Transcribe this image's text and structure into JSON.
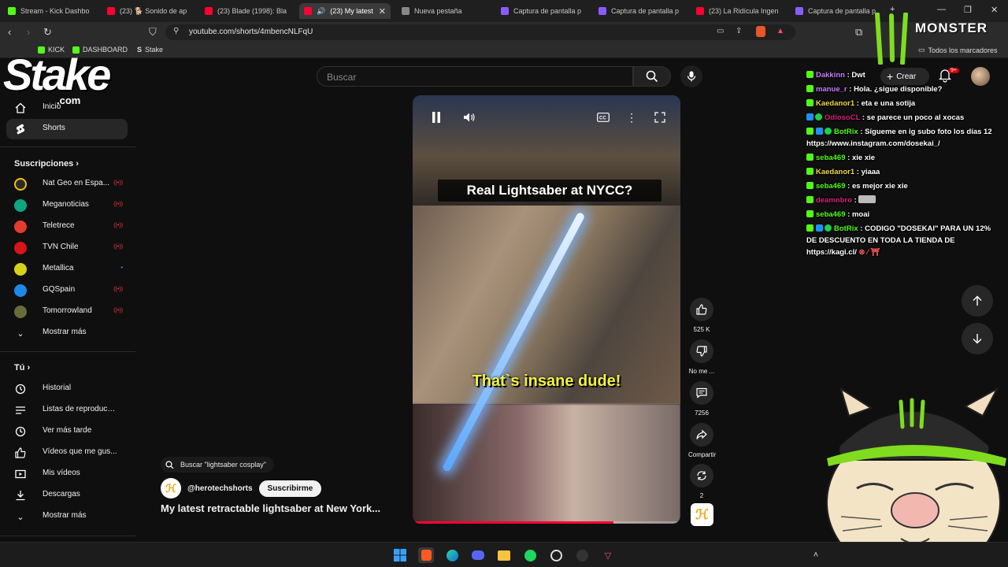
{
  "browser": {
    "tabs": [
      {
        "label": "Stream - Kick Dashbo",
        "color": "#53fc18"
      },
      {
        "label": "(23) 🐕 Sonido de ap",
        "color": "#ff0033"
      },
      {
        "label": "(23) Blade (1998): Bla",
        "color": "#ff0033"
      },
      {
        "label": "(23) My latest",
        "color": "#ff0033",
        "active": true
      },
      {
        "label": "Nueva pestaña",
        "color": "#888888"
      },
      {
        "label": "Captura de pantalla p",
        "color": "#8a5cff"
      },
      {
        "label": "Captura de pantalla p",
        "color": "#8a5cff"
      },
      {
        "label": "(23) La Ridícula Ingen",
        "color": "#ff0033"
      },
      {
        "label": "Captura de pantalla p",
        "color": "#8a5cff"
      }
    ],
    "url": "youtube.com/shorts/4mbencNLFqU",
    "bookmarks": [
      "KICK",
      "DASHBOARD",
      "Stake"
    ],
    "bookmarks_all": "Todos los marcadores"
  },
  "search": {
    "placeholder": "Buscar"
  },
  "sidebar": {
    "main": [
      {
        "label": "Inicio",
        "icon": "home-icon"
      },
      {
        "label": "Shorts",
        "icon": "shorts-icon"
      }
    ],
    "subs_title": "Suscripciones",
    "subs": [
      {
        "label": "Nat Geo en Espa...",
        "color": "#2b2b2b"
      },
      {
        "label": "Meganoticias",
        "color": "#0ea683"
      },
      {
        "label": "Teletrece",
        "color": "#e33b2e"
      },
      {
        "label": "TVN Chile",
        "color": "#d7141a"
      },
      {
        "label": "Metallica",
        "color": "#d6d21a"
      },
      {
        "label": "GQSpain",
        "color": "#1e88e5"
      },
      {
        "label": "Tomorrowland",
        "color": "#6b6b3a"
      }
    ],
    "show_more": "Mostrar más",
    "you_title": "Tú",
    "you": [
      {
        "label": "Historial",
        "icon": "history-icon"
      },
      {
        "label": "Listas de reproducc...",
        "icon": "playlist-icon"
      },
      {
        "label": "Ver más tarde",
        "icon": "clock-icon"
      },
      {
        "label": "Vídeos que me gus...",
        "icon": "thumb-up-icon"
      },
      {
        "label": "Mis vídeos",
        "icon": "video-icon"
      },
      {
        "label": "Descargas",
        "icon": "download-icon"
      }
    ],
    "show_more_2": "Mostrar más"
  },
  "short": {
    "caption_top": "Real Lightsaber at NYCC?",
    "caption_bottom": "That`s insane dude!",
    "progress": 0.75,
    "actions": {
      "likes": "525 K",
      "dislike": "No me ...",
      "comments": "7256",
      "share": "Compartir",
      "remix": "2"
    },
    "search_chip": "Buscar \"lightsaber cosplay\"",
    "channel": "@herotechshorts",
    "subscribe": "Suscribirme",
    "title": "My latest retractable lightsaber at New York..."
  },
  "topright": {
    "create": "Crear",
    "notif_badge": "9+"
  },
  "chat": [
    {
      "user": "Dakkinn",
      "msg": "Dwt",
      "color": "#c77dff"
    },
    {
      "user": "manue_r",
      "msg": "Hola. ¿sigue disponible?",
      "color": "#c77dff"
    },
    {
      "user": "Kaedanor1",
      "msg": "eta e una sotija",
      "color": "#f5d742"
    },
    {
      "user": "OdiosoCL",
      "msg": "se parece un poco al xocas",
      "color": "#d9207a"
    },
    {
      "user": "BotRix",
      "msg": "Sígueme en ig subo foto los días 12 https://www.instagram.com/dosekai_/",
      "color": "#53fc18"
    },
    {
      "user": "seba469",
      "msg": "xie xie",
      "color": "#53fc18"
    },
    {
      "user": "Kaedanor1",
      "msg": "yiaaa",
      "color": "#f5d742"
    },
    {
      "user": "seba469",
      "msg": "es mejor xie xie",
      "color": "#53fc18"
    },
    {
      "user": "deamnbro",
      "msg": "",
      "color": "#d9207a"
    },
    {
      "user": "seba469",
      "msg": "moai",
      "color": "#53fc18"
    },
    {
      "user": "BotRix",
      "msg": "CODIGO \"DOSEKAI\" PARA UN 12% DE DESCUENTO EN TODA LA TIENDA DE https://kagi.cl/",
      "color": "#53fc18"
    }
  ],
  "overlay": {
    "stake": "Stake",
    "stake_com": ".com",
    "monster": "MONSTER"
  }
}
